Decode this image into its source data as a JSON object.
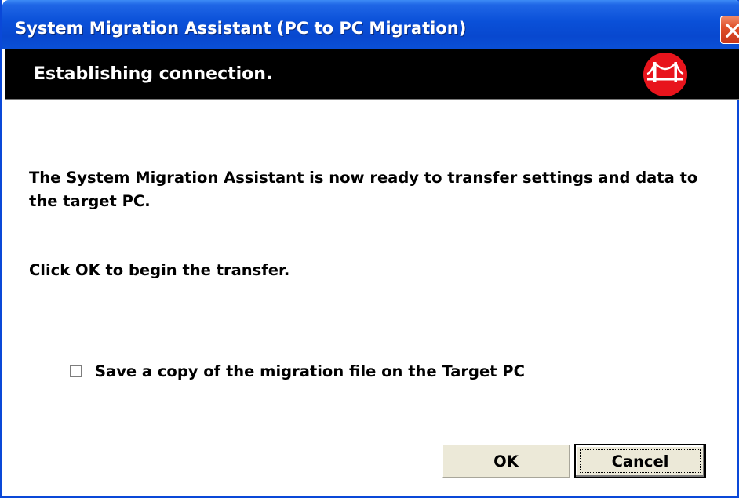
{
  "window": {
    "title": "System Migration Assistant (PC to PC Migration)",
    "close_icon": "close-icon"
  },
  "banner": {
    "title": "Establishing connection.",
    "logo_icon": "bridge-logo-icon"
  },
  "message": {
    "body": "The System Migration Assistant is now ready to transfer settings and data to the target PC.",
    "instruction": "Click OK to begin the transfer."
  },
  "options": {
    "save_copy_label": "Save a copy of the migration file on the Target PC",
    "save_copy_checked": false
  },
  "buttons": {
    "ok_label": "OK",
    "cancel_label": "Cancel"
  },
  "colors": {
    "titlebar": "#0a50d8",
    "banner": "#000000",
    "logo_red": "#e8141c",
    "button_face": "#ece9d8"
  }
}
